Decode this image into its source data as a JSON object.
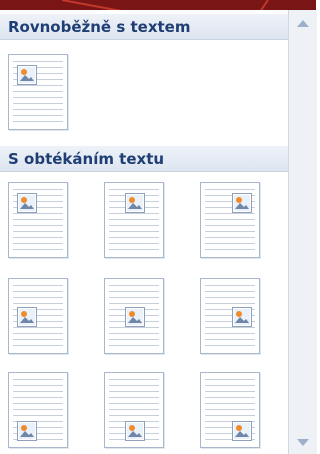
{
  "sections": [
    {
      "title": "Rovnoběžně s textem"
    },
    {
      "title": "S obtékáním textu"
    }
  ],
  "icons": {
    "thumbnail": "page-with-picture-icon",
    "scroll_up": "scroll-up-arrow-icon",
    "scroll_down": "scroll-down-arrow-icon"
  },
  "colors": {
    "header_text": "#1f3f74",
    "top_bar": "#7a1515",
    "callout": "#c0392b"
  }
}
